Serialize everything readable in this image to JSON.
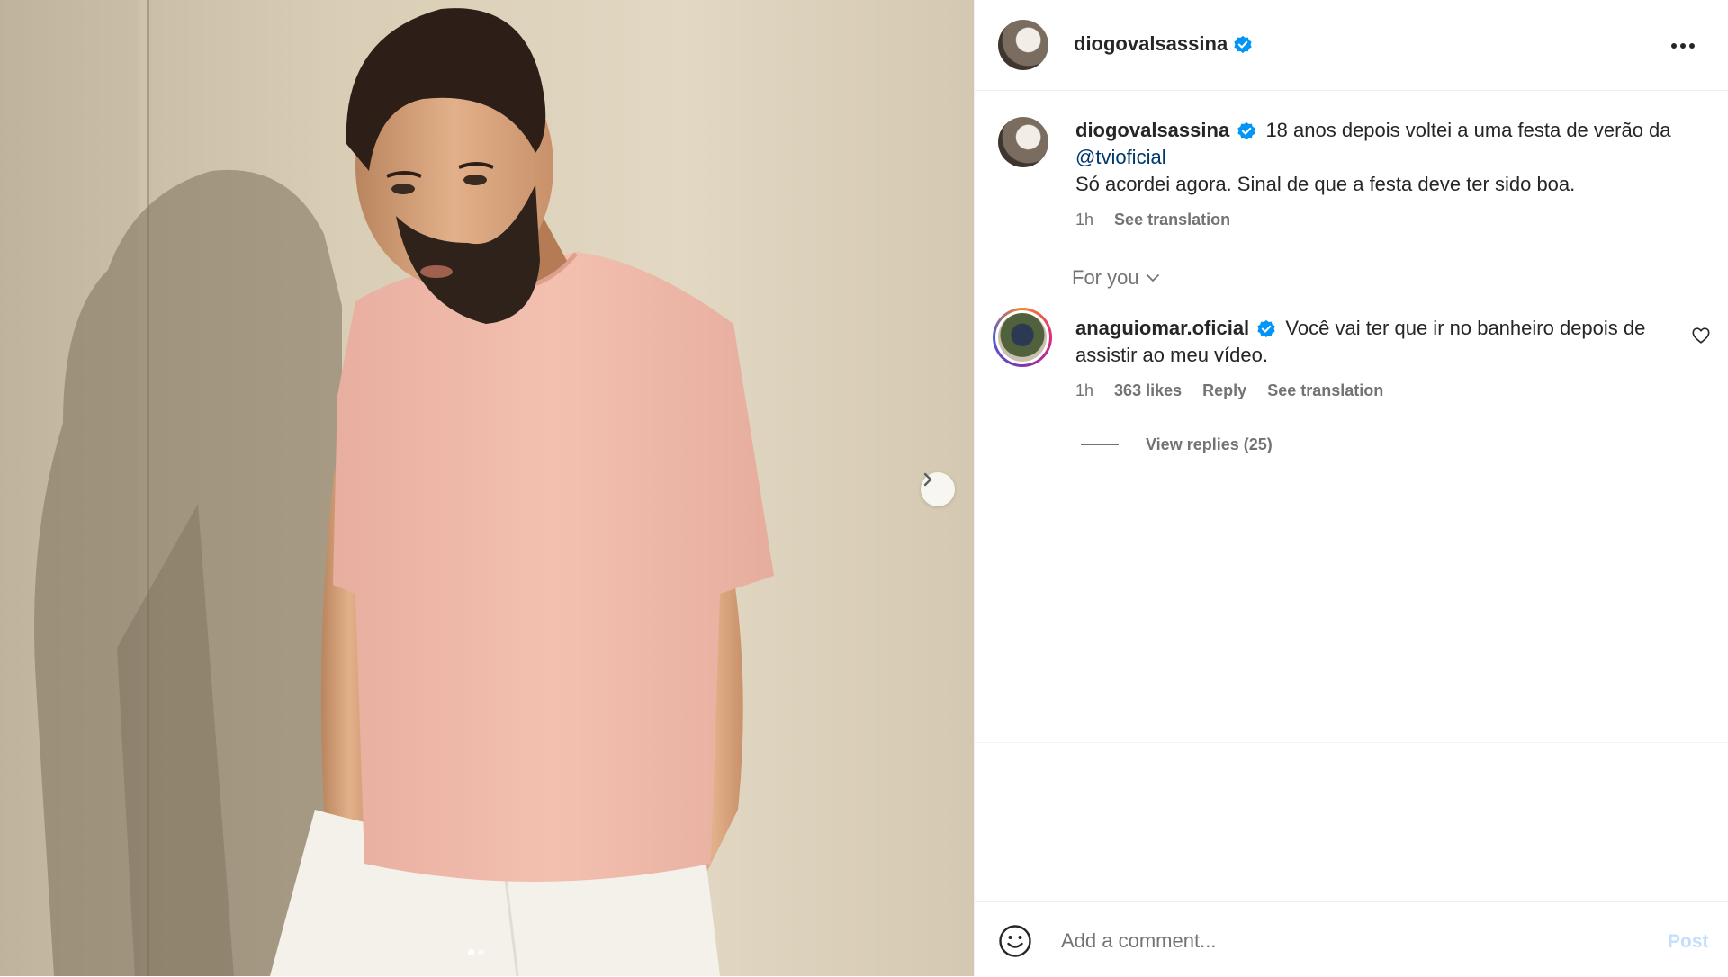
{
  "post": {
    "author": "diogovalsassina",
    "verified": true,
    "more_icon": "more-horizontal-icon",
    "next_icon": "chevron-right-icon",
    "carousel": {
      "count": 2,
      "active_index": 0
    }
  },
  "caption": {
    "username": "diogovalsassina",
    "text_line1": "18 anos depois voltei a uma festa de verão da",
    "mention": "@tvioficial",
    "text_line2": "Só acordei agora. Sinal de que a festa deve ter sido boa.",
    "time": "1h",
    "see_translation": "See translation"
  },
  "filter": {
    "label": "For you",
    "icon": "chevron-down-icon"
  },
  "comment": {
    "username": "anaguiomar.oficial",
    "verified": true,
    "text": "Você vai ter que ir no banheiro depois de assistir ao meu vídeo.",
    "time": "1h",
    "likes": "363 likes",
    "reply": "Reply",
    "see_translation": "See translation",
    "view_replies": "View replies (25)",
    "like_icon": "heart-outline-icon"
  },
  "composer": {
    "emoji_icon": "smiley-icon",
    "placeholder": "Add a comment...",
    "post_label": "Post"
  },
  "colors": {
    "verified_blue": "#0095f6",
    "mention": "#00376b",
    "muted_text": "#737373",
    "post_disabled": "#c2e0fd"
  }
}
